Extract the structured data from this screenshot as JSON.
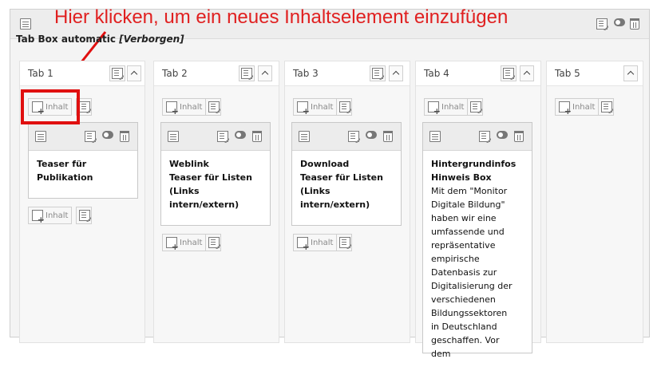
{
  "annotation": {
    "text": "Hier klicken, um ein neues Inhaltselement einzufügen"
  },
  "element": {
    "title": "Tab Box automatic",
    "hidden_label": "[Verborgen]"
  },
  "add_content_label": "Inhalt",
  "tabs": [
    {
      "label": "Tab 1"
    },
    {
      "label": "Tab 2"
    },
    {
      "label": "Tab 3"
    },
    {
      "label": "Tab 4"
    },
    {
      "label": "Tab 5"
    }
  ],
  "cards": [
    {
      "title_lines": [
        "Teaser für",
        "Publikation"
      ],
      "body": ""
    },
    {
      "title_lines": [
        "Weblink",
        "Teaser für Listen",
        "(Links",
        "intern/extern)"
      ],
      "body": ""
    },
    {
      "title_lines": [
        "Download",
        "Teaser für Listen",
        "(Links",
        "intern/extern)"
      ],
      "body": ""
    },
    {
      "title_lines": [
        "Hintergrundinfos",
        "Hinweis Box"
      ],
      "body": "Mit dem \"Monitor Digitale Bildung\" haben wir eine umfassende und repräsentative empirische Datenbasis zur Digitalisierung der verschiedenen Bildungssektoren in Deutschland geschaffen. Vor dem"
    }
  ],
  "colors": {
    "annotation": "#e02020"
  }
}
